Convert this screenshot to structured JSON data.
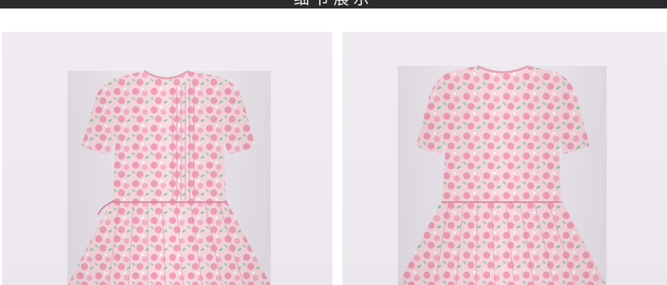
{
  "header": {
    "title": "细节展示"
  },
  "photos": [
    {
      "view": "front",
      "subject": "dress-front"
    },
    {
      "view": "back",
      "subject": "dress-back"
    }
  ],
  "colors": {
    "header_bg": "#2b2b2e",
    "backdrop": "#eeeaf0",
    "fabric_base": "#f7d6de",
    "fabric_pink": "#f08aa8",
    "fabric_green": "#7fcca0"
  }
}
